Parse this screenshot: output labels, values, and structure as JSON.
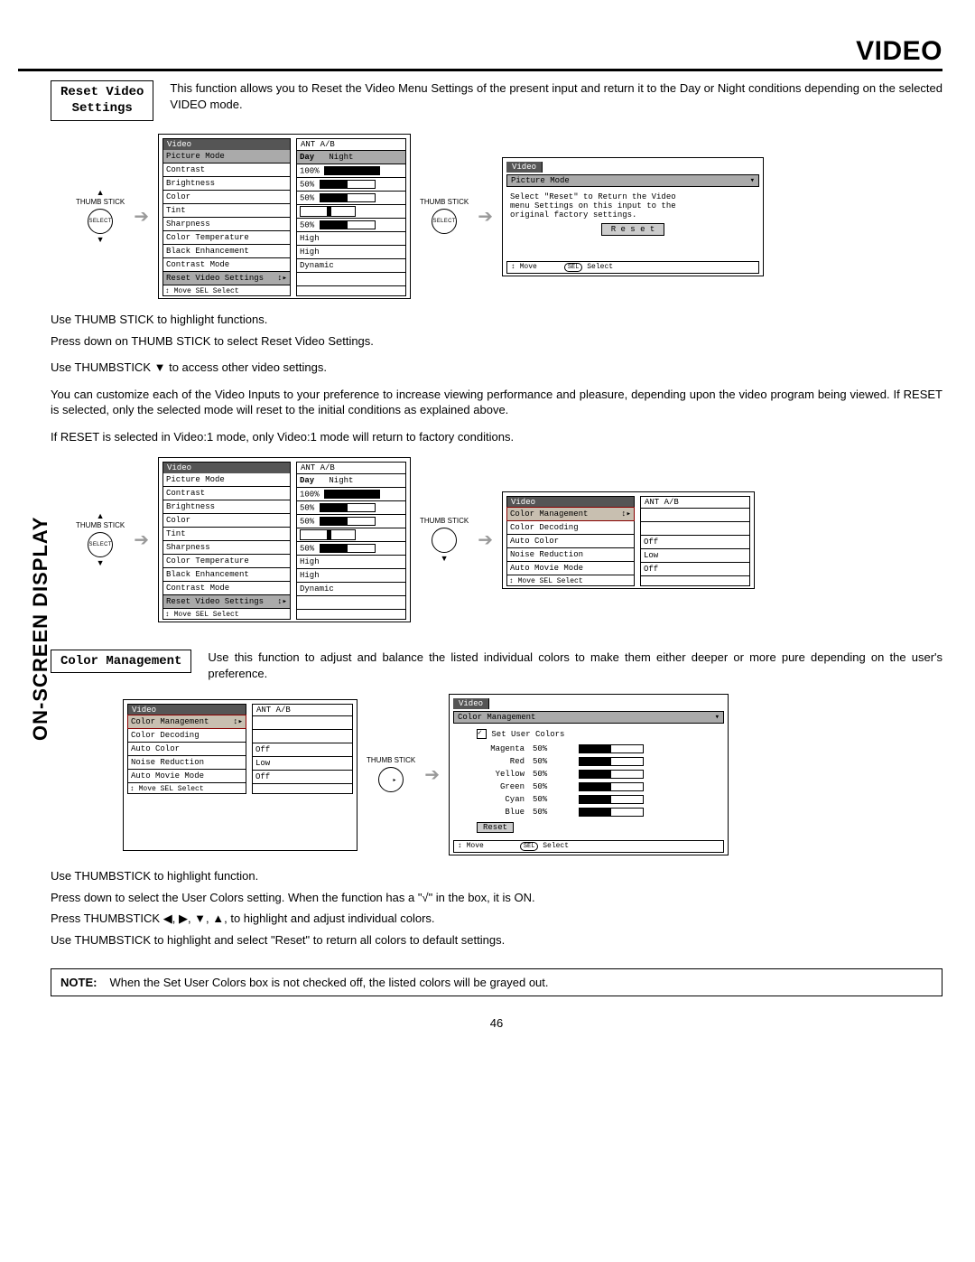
{
  "header_title": "VIDEO",
  "side_label": "ON-SCREEN DISPLAY",
  "section1": {
    "box_line1": "Reset Video",
    "box_line2": "Settings",
    "description": "This function allows you to Reset the Video Menu Settings of the present input and return it to the Day or Night conditions depending on the selected VIDEO mode."
  },
  "thumb_label": "THUMB STICK",
  "select_label": "SELECT",
  "osdA": {
    "tab_left": "Video",
    "tab_right": "ANT A/B",
    "rows": [
      {
        "label": "Picture Mode",
        "val": "Day    Night",
        "hl": true
      },
      {
        "label": "Contrast",
        "val": "100%",
        "bar": "full"
      },
      {
        "label": "Brightness",
        "val": "50%",
        "bar": "half"
      },
      {
        "label": "Color",
        "val": "50%",
        "bar": "half"
      },
      {
        "label": "Tint",
        "val": "",
        "marker": true
      },
      {
        "label": "Sharpness",
        "val": "50%",
        "bar": "half"
      },
      {
        "label": "Color Temperature",
        "val": "High"
      },
      {
        "label": "Black Enhancement",
        "val": "High"
      },
      {
        "label": "Contrast Mode",
        "val": "Dynamic"
      },
      {
        "label": "Reset Video Settings",
        "val": "",
        "hl": true,
        "arrows": "↕▸"
      }
    ],
    "footer": "↕ Move  SEL Select"
  },
  "osdB": {
    "tab_left": "Video",
    "row_picture": "Picture Mode",
    "msg_l1": "Select \"Reset\" to Return the Video",
    "msg_l2": "menu Settings on this input to the",
    "msg_l3": "original factory settings.",
    "reset_btn": "R e s e t",
    "footer_move": "↕ Move",
    "footer_sel": "SEL  Select"
  },
  "paras1": [
    "Use THUMB STICK to highlight functions.",
    "Press down on THUMB STICK to select Reset Video Settings.",
    "Use THUMBSTICK ▼ to access other video settings.",
    "You can customize each of the Video Inputs to your preference to increase viewing performance and pleasure, depending upon the video program being viewed. If RESET is selected, only the selected mode will reset to the initial conditions as explained above.",
    "If RESET is selected in Video:1 mode, only Video:1 mode will return to factory conditions."
  ],
  "osdC": {
    "tab_left": "Video",
    "tab_right": "ANT A/B",
    "rows": [
      {
        "label": "Picture Mode",
        "val": "Day    Night"
      },
      {
        "label": "Contrast",
        "val": "100%",
        "bar": "full"
      },
      {
        "label": "Brightness",
        "val": "50%",
        "bar": "half"
      },
      {
        "label": "Color",
        "val": "50%",
        "bar": "half"
      },
      {
        "label": "Tint",
        "val": "",
        "marker": true
      },
      {
        "label": "Sharpness",
        "val": "50%",
        "bar": "half"
      },
      {
        "label": "Color Temperature",
        "val": "High"
      },
      {
        "label": "Black Enhancement",
        "val": "High"
      },
      {
        "label": "Contrast Mode",
        "val": "Dynamic"
      },
      {
        "label": "Reset Video Settings",
        "val": "",
        "hl": true,
        "arrows": "↕▸"
      }
    ],
    "footer": "↕ Move  SEL Select"
  },
  "osdD": {
    "tab_left": "Video",
    "tab_right": "ANT A/B",
    "rows": [
      {
        "label": "Color Management",
        "val": "",
        "hlred": true,
        "arrows": "↕▸"
      },
      {
        "label": "Color Decoding",
        "val": ""
      },
      {
        "label": "Auto Color",
        "val": "Off"
      },
      {
        "label": "Noise Reduction",
        "val": "Low"
      },
      {
        "label": "Auto Movie Mode",
        "val": "Off"
      }
    ],
    "footer": "↕ Move  SEL Select"
  },
  "section2": {
    "box": "Color Management",
    "description": "Use this function to adjust and balance the listed individual colors to make them either deeper or more pure depending on the user's preference."
  },
  "osdE": {
    "tab_left": "Video",
    "tab_right": "ANT A/B",
    "rows": [
      {
        "label": "Color Management",
        "val": "",
        "hlred": true,
        "arrows": "↕▸"
      },
      {
        "label": "Color Decoding",
        "val": ""
      },
      {
        "label": "Auto Color",
        "val": "Off"
      },
      {
        "label": "Noise Reduction",
        "val": "Low"
      },
      {
        "label": "Auto Movie Mode",
        "val": "Off"
      }
    ],
    "footer": "↕ Move  SEL Select"
  },
  "osdF": {
    "tab_left": "Video",
    "row_top": "Color Management",
    "set_user": "Set User Colors",
    "colors": [
      {
        "name": "Magenta",
        "pct": "50%"
      },
      {
        "name": "Red",
        "pct": "50%"
      },
      {
        "name": "Yellow",
        "pct": "50%"
      },
      {
        "name": "Green",
        "pct": "50%"
      },
      {
        "name": "Cyan",
        "pct": "50%"
      },
      {
        "name": "Blue",
        "pct": "50%"
      }
    ],
    "reset_btn": "Reset",
    "footer_move": "↕ Move",
    "footer_sel": "SEL  Select"
  },
  "paras2": [
    "Use THUMBSTICK to highlight function.",
    "Press down to select the User Colors setting.  When the function has a \"√\" in the box, it is ON.",
    "Press THUMBSTICK ◀, ▶, ▼, ▲, to highlight and adjust individual colors.",
    "Use THUMBSTICK to highlight and select \"Reset\" to return all colors to default settings."
  ],
  "note_label": "NOTE:",
  "note_text": "When the Set User Colors box is not checked off, the listed colors will be grayed out.",
  "page_number": "46"
}
